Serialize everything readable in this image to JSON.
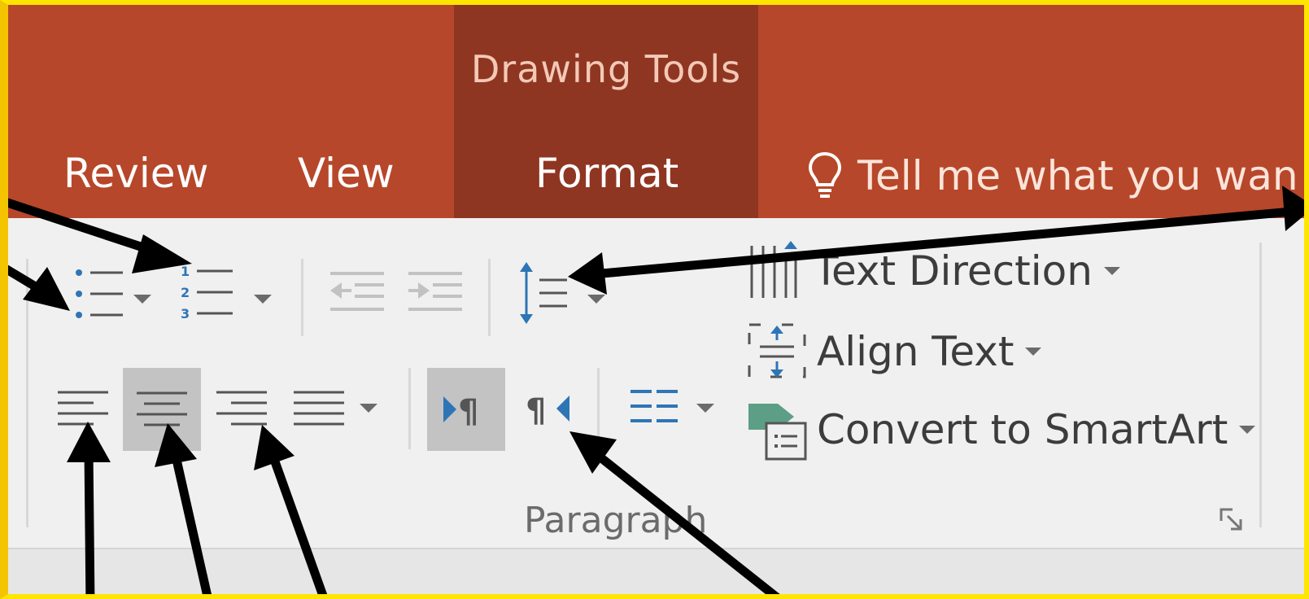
{
  "contextual_group": {
    "title": "Drawing Tools"
  },
  "tabs": [
    {
      "label": "Review"
    },
    {
      "label": "View"
    },
    {
      "label": "Format"
    }
  ],
  "tell_me": {
    "text": "Tell me what you wan",
    "icon": "lightbulb-icon"
  },
  "ribbon": {
    "group_label": "Paragraph",
    "commands": [
      {
        "label": "Text Direction",
        "icon": "text-direction-icon"
      },
      {
        "label": "Align Text",
        "icon": "align-text-icon"
      },
      {
        "label": "Convert to SmartArt",
        "icon": "smartart-icon"
      }
    ],
    "buttons": [
      {
        "name": "bullets",
        "icon": "bullets-icon"
      },
      {
        "name": "numbering",
        "icon": "numbering-icon"
      },
      {
        "name": "decrease-indent",
        "icon": "decrease-indent-icon",
        "state": "disabled"
      },
      {
        "name": "increase-indent",
        "icon": "increase-indent-icon",
        "state": "disabled"
      },
      {
        "name": "line-spacing",
        "icon": "line-spacing-icon"
      },
      {
        "name": "align-left",
        "icon": "align-left-icon"
      },
      {
        "name": "center",
        "icon": "align-center-icon",
        "state": "pressed"
      },
      {
        "name": "align-right",
        "icon": "align-right-icon"
      },
      {
        "name": "justify",
        "icon": "justify-icon"
      },
      {
        "name": "left-to-right",
        "icon": "ltr-paragraph-icon",
        "state": "pressed"
      },
      {
        "name": "right-to-left",
        "icon": "rtl-paragraph-icon"
      },
      {
        "name": "columns",
        "icon": "columns-icon"
      }
    ]
  },
  "colors": {
    "title_bar": "#b7472a",
    "contextual_tab": "#8f3622",
    "ribbon_bg": "#f0f0f0",
    "accent_blue": "#2e75b6",
    "frame_border": "#ffe600"
  }
}
